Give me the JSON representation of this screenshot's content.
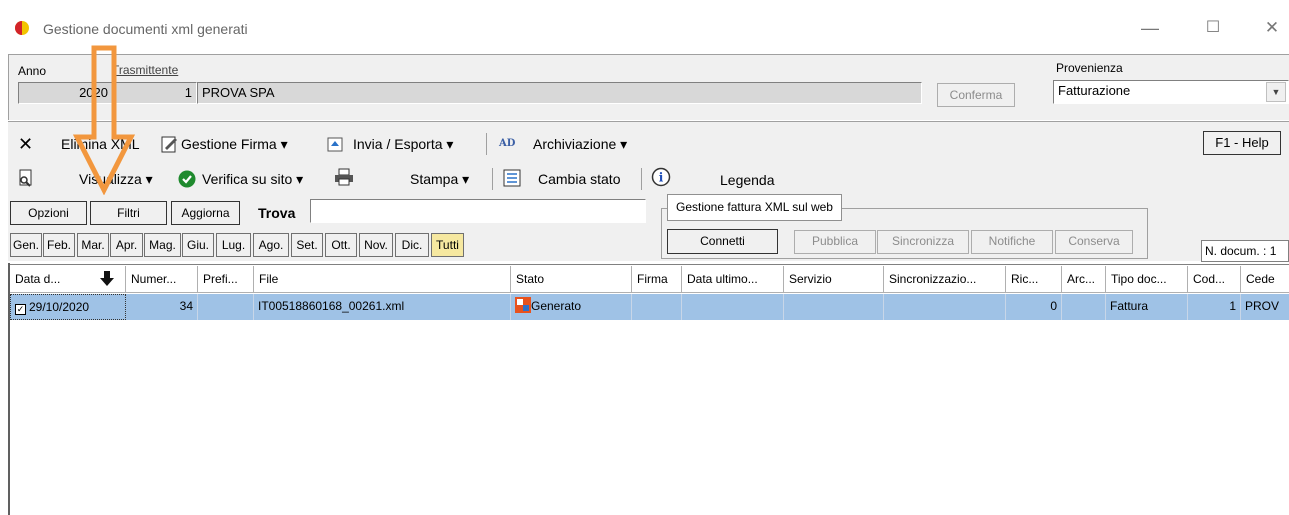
{
  "window": {
    "title": "Gestione documenti xml generati",
    "minimize_glyph": "—",
    "maximize_glyph": "☐",
    "close_glyph": "✕"
  },
  "header": {
    "anno_label": "Anno",
    "anno_value": "2020",
    "trasmittente_label": "Trasmittente",
    "trasmittente_num": "1",
    "trasmittente_name": "PROVA SPA",
    "conferma_label": "Conferma",
    "provenienza_label": "Provenienza",
    "provenienza_value": "Fatturazione"
  },
  "toolbar1": {
    "elimina": "Elimina XML",
    "gestione_firma": "Gestione Firma",
    "invia_esporta": "Invia / Esporta",
    "archiviazione": "Archiviazione",
    "help": "F1 - Help"
  },
  "toolbar2": {
    "visualizza": "Visualizza",
    "verifica": "Verifica su sito",
    "stampa": "Stampa",
    "cambia_stato": "Cambia stato",
    "legenda": "Legenda"
  },
  "toolbar3": {
    "opzioni": "Opzioni",
    "filtri": "Filtri",
    "aggiorna": "Aggiorna",
    "trova": "Trova",
    "trova_value": ""
  },
  "web_group": {
    "title": "Gestione fattura XML sul web",
    "connetti": "Connetti",
    "pubblica": "Pubblica",
    "sincronizza": "Sincronizza",
    "notifiche": "Notifiche",
    "conserva": "Conserva"
  },
  "months": [
    "Gen.",
    "Feb.",
    "Mar.",
    "Apr.",
    "Mag.",
    "Giu.",
    "Lug.",
    "Ago.",
    "Set.",
    "Ott.",
    "Nov.",
    "Dic.",
    "Tutti"
  ],
  "n_docum": "N. docum. : 1",
  "table": {
    "headers": [
      "Data d...",
      "Numer...",
      "Prefi...",
      "File",
      "Stato",
      "Firma",
      "Data ultimo...",
      "Servizio",
      "Sincronizzazio...",
      "Ric...",
      "Arc...",
      "Tipo doc...",
      "Cod...",
      "Cede"
    ],
    "rows": [
      {
        "data": "29/10/2020",
        "numero": "34",
        "prefisso": "",
        "file": "IT00518860168_00261.xml",
        "stato": "Generato",
        "firma": "",
        "data_ultimo": "",
        "servizio": "",
        "sincronizzazione": "",
        "ric": "0",
        "arc": "",
        "tipo_doc": "Fattura",
        "cod": "1",
        "cede": "PROV"
      }
    ]
  }
}
